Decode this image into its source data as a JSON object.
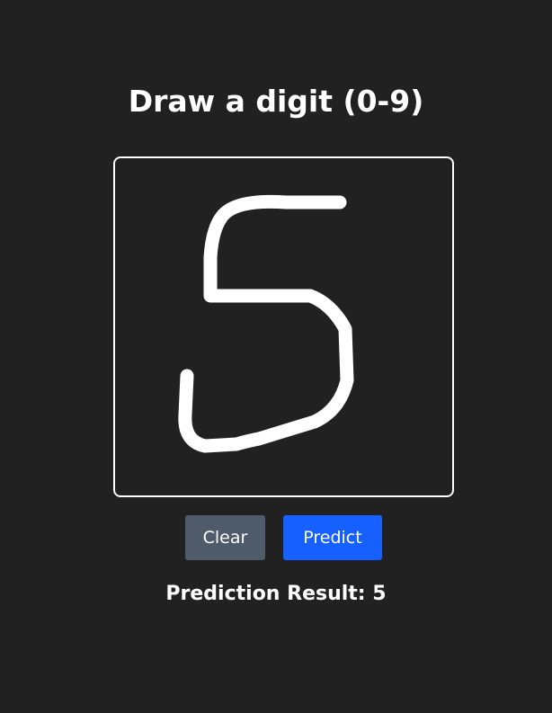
{
  "header": {
    "title": "Draw a digit (0-9)"
  },
  "canvas": {
    "stroke_color": "#ffffff",
    "background_color": "#212121",
    "drawn_digit": "5"
  },
  "buttons": {
    "clear_label": "Clear",
    "predict_label": "Predict",
    "clear_color": "#4f5a6b",
    "predict_color": "#1660ff"
  },
  "result": {
    "label": "Prediction Result: 5"
  }
}
